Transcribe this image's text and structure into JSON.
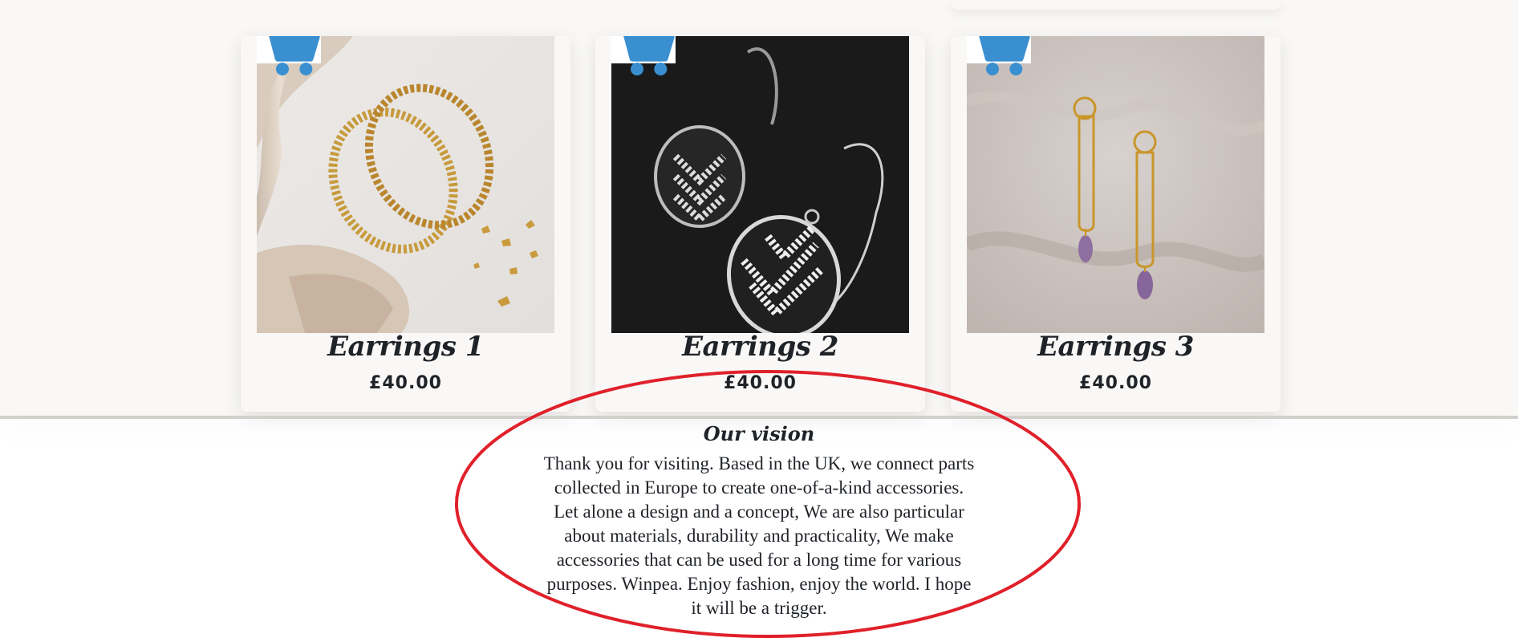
{
  "products": [
    {
      "title": "Earrings 1",
      "price": "£40.00",
      "cart_icon": "shopping-cart-icon"
    },
    {
      "title": "Earrings 2",
      "price": "£40.00",
      "cart_icon": "shopping-cart-icon"
    },
    {
      "title": "Earrings 3",
      "price": "£40.00",
      "cart_icon": "shopping-cart-icon"
    }
  ],
  "vision": {
    "title": "Our vision",
    "lines": [
      "Thank you for visiting. Based in the UK, we connect parts",
      "collected in Europe to create one-of-a-kind accessories.",
      "Let alone a design and a concept, We are also particular",
      "about materials, durability and practicality, We make",
      "accessories that can be used for a long time for various",
      "purposes. Winpea. Enjoy fashion, enjoy the world. I hope",
      "it will be a trigger."
    ]
  },
  "colors": {
    "cart_icon": "#3a8fd1",
    "page_background": "#f9f8f6",
    "text": "#1f2328",
    "annotation_ellipse": "#e0202a"
  }
}
